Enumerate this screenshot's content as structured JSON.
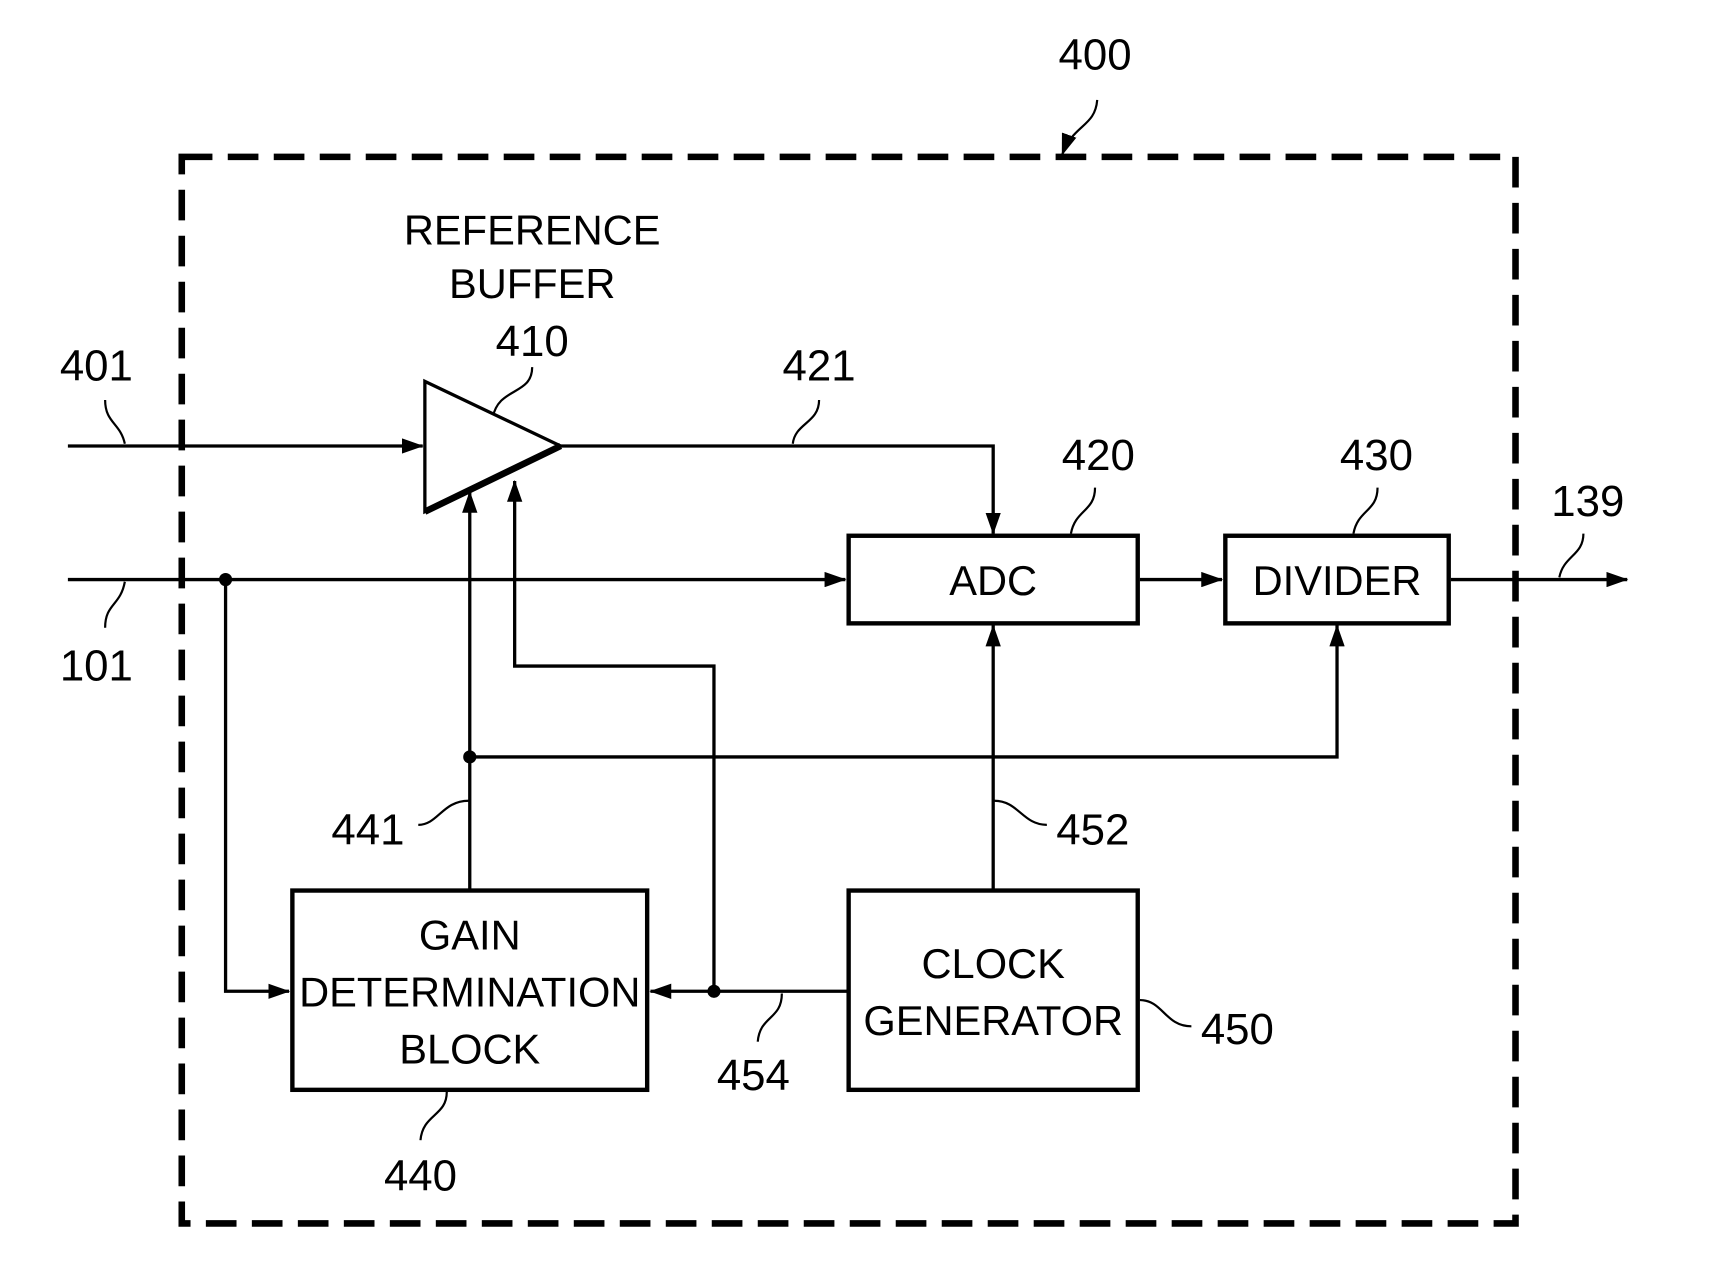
{
  "figure": {
    "module_ref": "400",
    "blocks": {
      "reference_buffer": {
        "ref": "410",
        "title_lines": [
          "REFERENCE",
          "BUFFER"
        ]
      },
      "adc": {
        "ref": "420",
        "label": "ADC"
      },
      "divider": {
        "ref": "430",
        "label": "DIVIDER"
      },
      "gain_determination": {
        "ref": "440",
        "lines": [
          "GAIN",
          "DETERMINATION",
          "BLOCK"
        ]
      },
      "clock_generator": {
        "ref": "450",
        "lines": [
          "CLOCK",
          "GENERATOR"
        ]
      }
    },
    "signals": {
      "input_top": "401",
      "input_bottom": "101",
      "buffer_output": "421",
      "output": "139",
      "gain_signal": "441",
      "clock_to_adc": "452",
      "clock_to_gain": "454"
    },
    "colors": {
      "ink": "#000000",
      "paper": "#ffffff"
    }
  }
}
